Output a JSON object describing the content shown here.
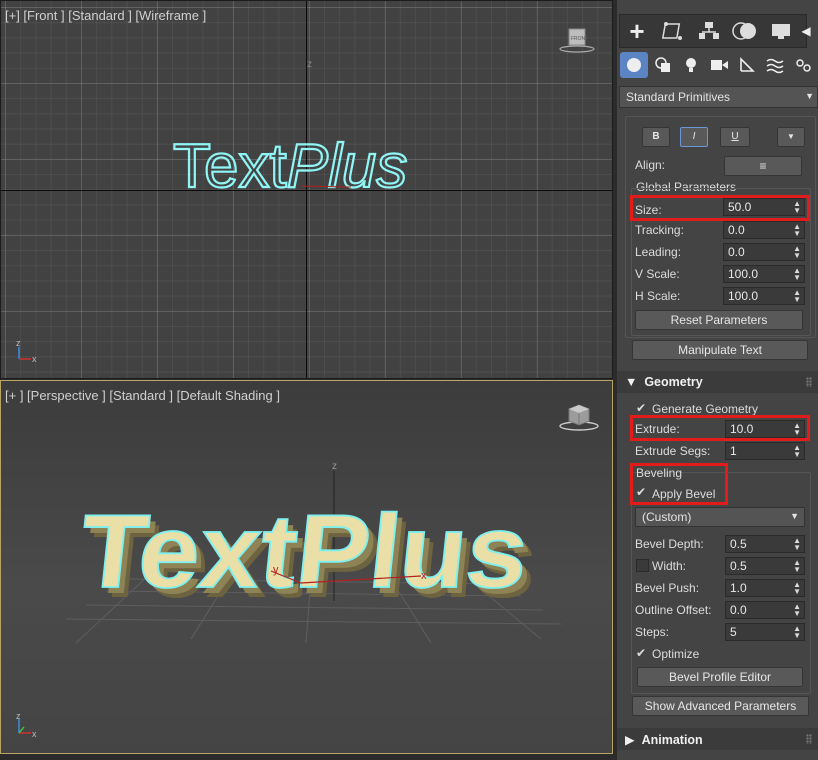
{
  "viewports": {
    "front": {
      "label": "[+] [Front ] [Standard ] [Wireframe ]",
      "axis_z": "z",
      "text": "TextPlus",
      "text_first": "Text",
      "text_second": "Plus"
    },
    "perspective": {
      "label": "[+ ] [Perspective ] [Standard ] [Default Shading ]",
      "text": "TextPlus",
      "axis_z": "z",
      "axis_x": "x",
      "axis_y": "y"
    },
    "tripod": {
      "x": "x",
      "y": "y",
      "z": "z"
    }
  },
  "panel": {
    "tabs": [
      "create-tab",
      "modify-tab",
      "hierarchy-tab",
      "motion-tab",
      "display-tab"
    ],
    "subtabs": [
      "geometry-icon",
      "shapes-icon",
      "lights-icon",
      "cameras-icon",
      "helpers-icon",
      "spacewarps-icon",
      "systems-icon"
    ],
    "category_dropdown": "Standard Primitives",
    "style_buttons": {
      "bold": "B",
      "italic": "I",
      "underline": "U"
    },
    "align": {
      "label": "Align:",
      "icon": "≡"
    },
    "global_parameters": {
      "title": "Global Parameters",
      "size": {
        "label": "Size:",
        "value": "50.0"
      },
      "tracking": {
        "label": "Tracking:",
        "value": "0.0"
      },
      "leading": {
        "label": "Leading:",
        "value": "0.0"
      },
      "v_scale": {
        "label": "V Scale:",
        "value": "100.0"
      },
      "h_scale": {
        "label": "H Scale:",
        "value": "100.0"
      },
      "reset": "Reset Parameters"
    },
    "manipulate": "Manipulate Text",
    "geometry": {
      "title": "Geometry",
      "generate": "Generate Geometry",
      "extrude": {
        "label": "Extrude:",
        "value": "10.0"
      },
      "extrude_segs": {
        "label": "Extrude Segs:",
        "value": "1"
      },
      "beveling": "Beveling",
      "apply_bevel": "Apply Bevel",
      "bevel_preset": "(Custom)",
      "bevel_depth": {
        "label": "Bevel Depth:",
        "value": "0.5"
      },
      "width": {
        "label": "Width:",
        "value": "0.5"
      },
      "bevel_push": {
        "label": "Bevel Push:",
        "value": "1.0"
      },
      "outline_offset": {
        "label": "Outline Offset:",
        "value": "0.0"
      },
      "steps": {
        "label": "Steps:",
        "value": "5"
      },
      "optimize": "Optimize",
      "profile_editor": "Bevel Profile Editor",
      "show_advanced": "Show Advanced Parameters"
    },
    "animation": {
      "title": "Animation"
    }
  },
  "colors": {
    "highlight": "#e21b1b",
    "selected": "#5b84c4",
    "outline": "#7ff0f0",
    "text3d": "#e8dca0"
  }
}
